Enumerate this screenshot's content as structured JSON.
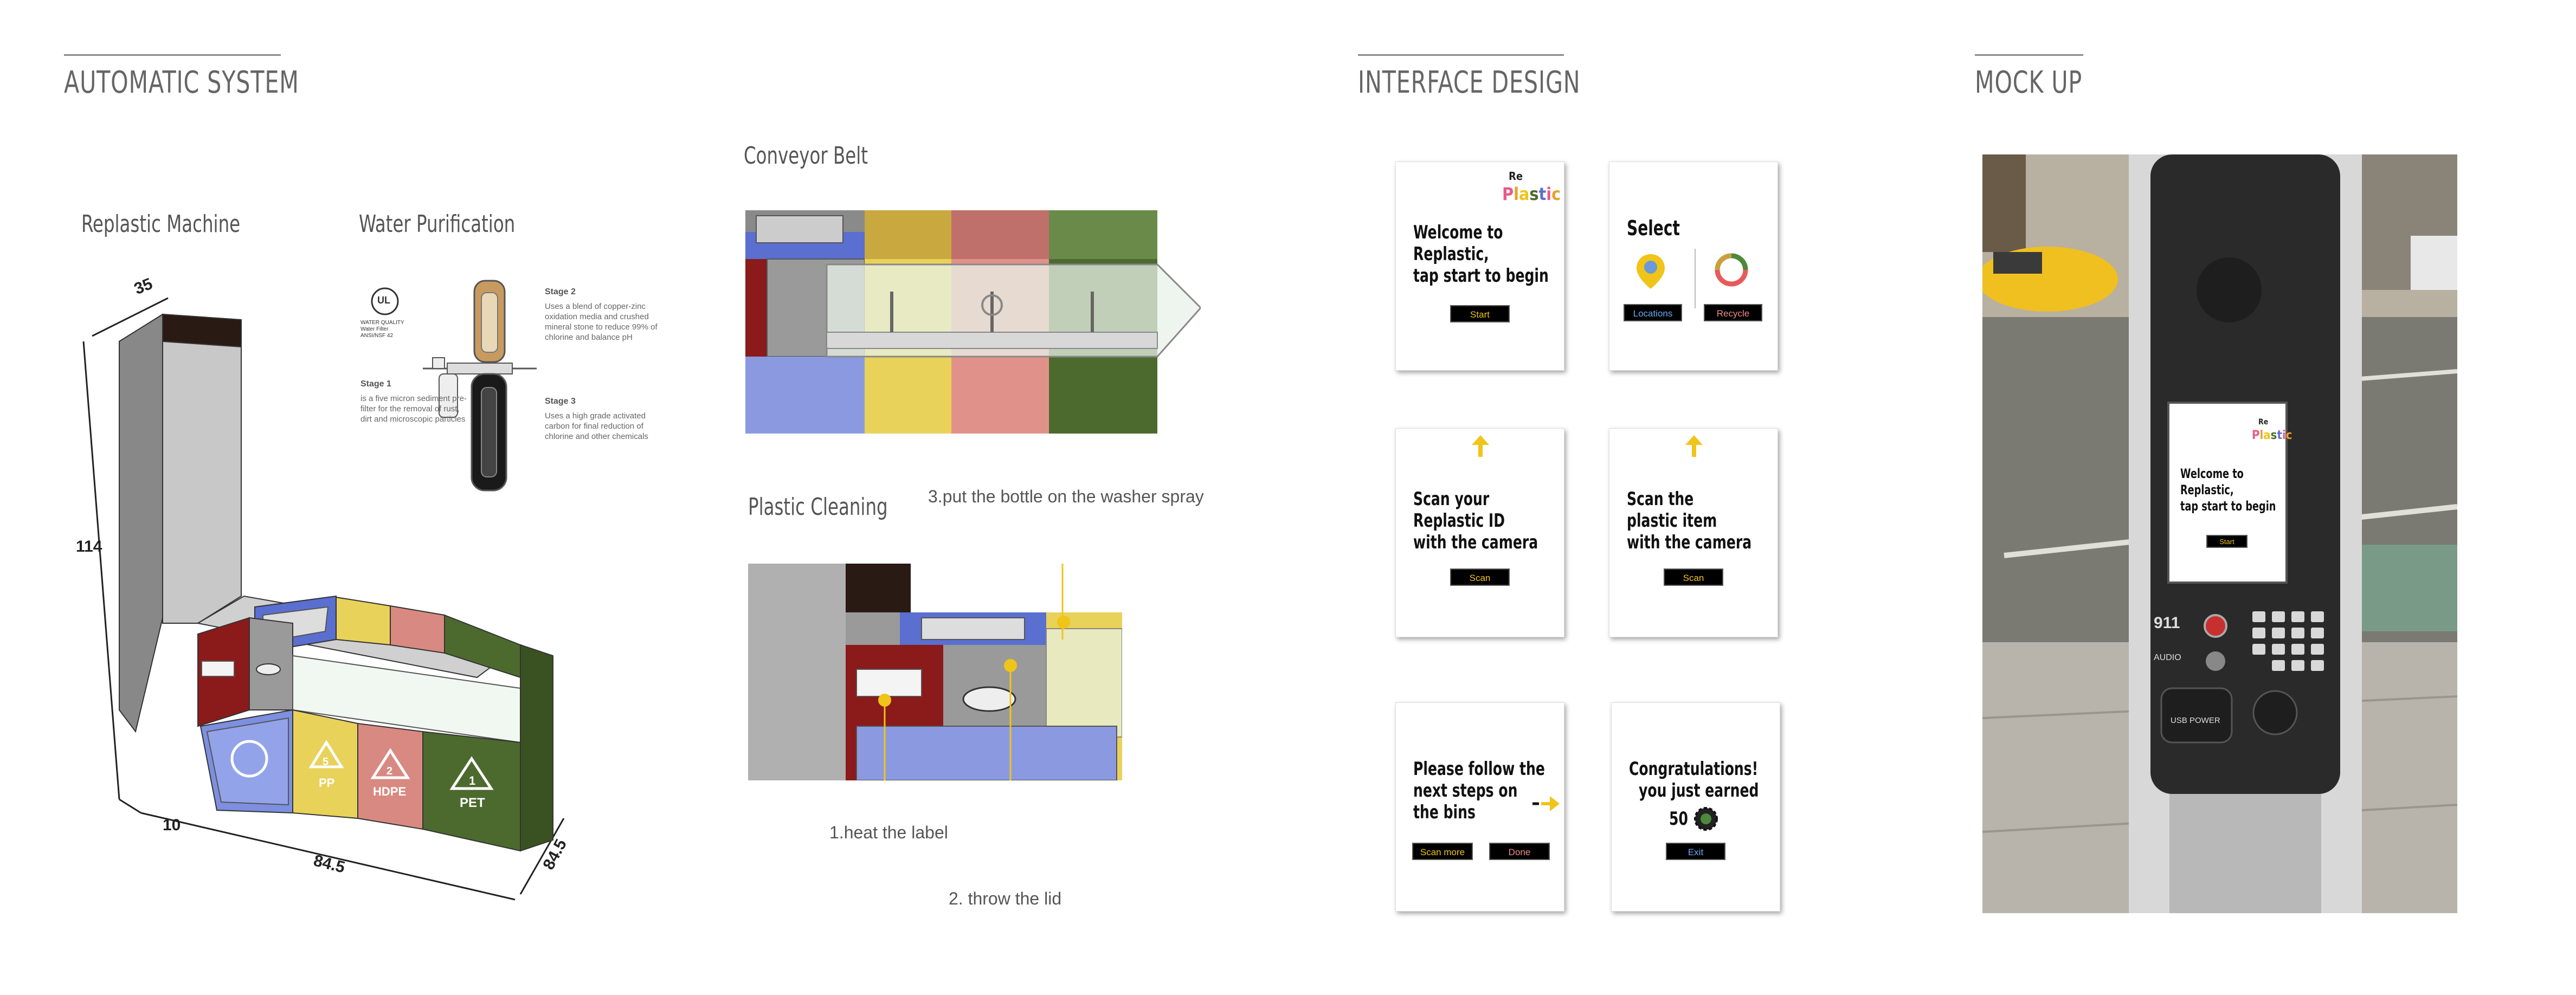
{
  "sections": {
    "automatic_system": "AUTOMATIC SYSTEM",
    "interface_design": "INTERFACE DESIGN",
    "mock_up": "MOCK UP"
  },
  "subtitles": {
    "replastic_machine": "Replastic Machine",
    "water_purification": "Water Purification",
    "conveyor_belt": "Conveyor Belt",
    "plastic_cleaning": "Plastic Cleaning"
  },
  "dimensions": {
    "depth": "35",
    "height": "114",
    "base": "10",
    "width": "84.5",
    "side": "84.5"
  },
  "bin_labels": {
    "pp": "PP",
    "pp_num": "5",
    "hdpe": "HDPE",
    "hdpe_num": "2",
    "pet": "PET",
    "pet_num": "1"
  },
  "water": {
    "stage1_title": "Stage 1",
    "stage1_text": "is a five micron sediment pre-filter for the removal of rust, dirt and microscopic particles",
    "stage2_title": "Stage 2",
    "stage2_text": "Uses a blend of copper-zinc oxidation media and crushed mineral stone to reduce 99% of chlorine and balance pH",
    "stage3_title": "Stage 3",
    "stage3_text": "Uses a high grade activated carbon for final reduction of chlorine and other chemicals",
    "ul_label": "UL",
    "ul_text": "WATER QUALITY Water Filter ANSI/NSF 42"
  },
  "cleaning_steps": {
    "step1": "1.heat the label",
    "step2": "2. throw the lid",
    "step3": "3.put the bottle on the washer spray"
  },
  "logo": {
    "re": "Re",
    "plastic": "Plastic"
  },
  "screens": {
    "welcome": {
      "text": [
        "Welcome to",
        "Replastic,",
        "tap start to begin"
      ],
      "button": "Start"
    },
    "select": {
      "title": "Select",
      "button_locations": "Locations",
      "button_recycle": "Recycle"
    },
    "scan_id": {
      "text": [
        "Scan your",
        "Replastic ID",
        "with the camera"
      ],
      "button": "Scan"
    },
    "scan_item": {
      "text": [
        "Scan the",
        "plastic item",
        "with the camera"
      ],
      "button": "Scan"
    },
    "follow": {
      "text": [
        "Please follow the",
        "next steps on",
        "the bins"
      ],
      "button_more": "Scan more",
      "button_done": "Done"
    },
    "congrats": {
      "text": [
        "Congratulations!",
        "you just earned"
      ],
      "points": "50",
      "button": "Exit"
    }
  },
  "mockup": {
    "kiosk_911": "911",
    "kiosk_audio": "AUDIO",
    "kiosk_usb": "USB POWER",
    "screen_text": [
      "Welcome to",
      "Replastic,",
      "tap start to begin"
    ],
    "screen_button": "Start"
  },
  "colors": {
    "accent_yellow": "#f0c419",
    "bin_red": "#8b1a1a",
    "bin_blue": "#5a6fd0",
    "bin_yellow": "#e8d25a",
    "bin_pink": "#d88a82",
    "bin_green": "#4c6a2e",
    "plastic_pink": "#e85a8a",
    "plastic_orange": "#e8a030"
  }
}
